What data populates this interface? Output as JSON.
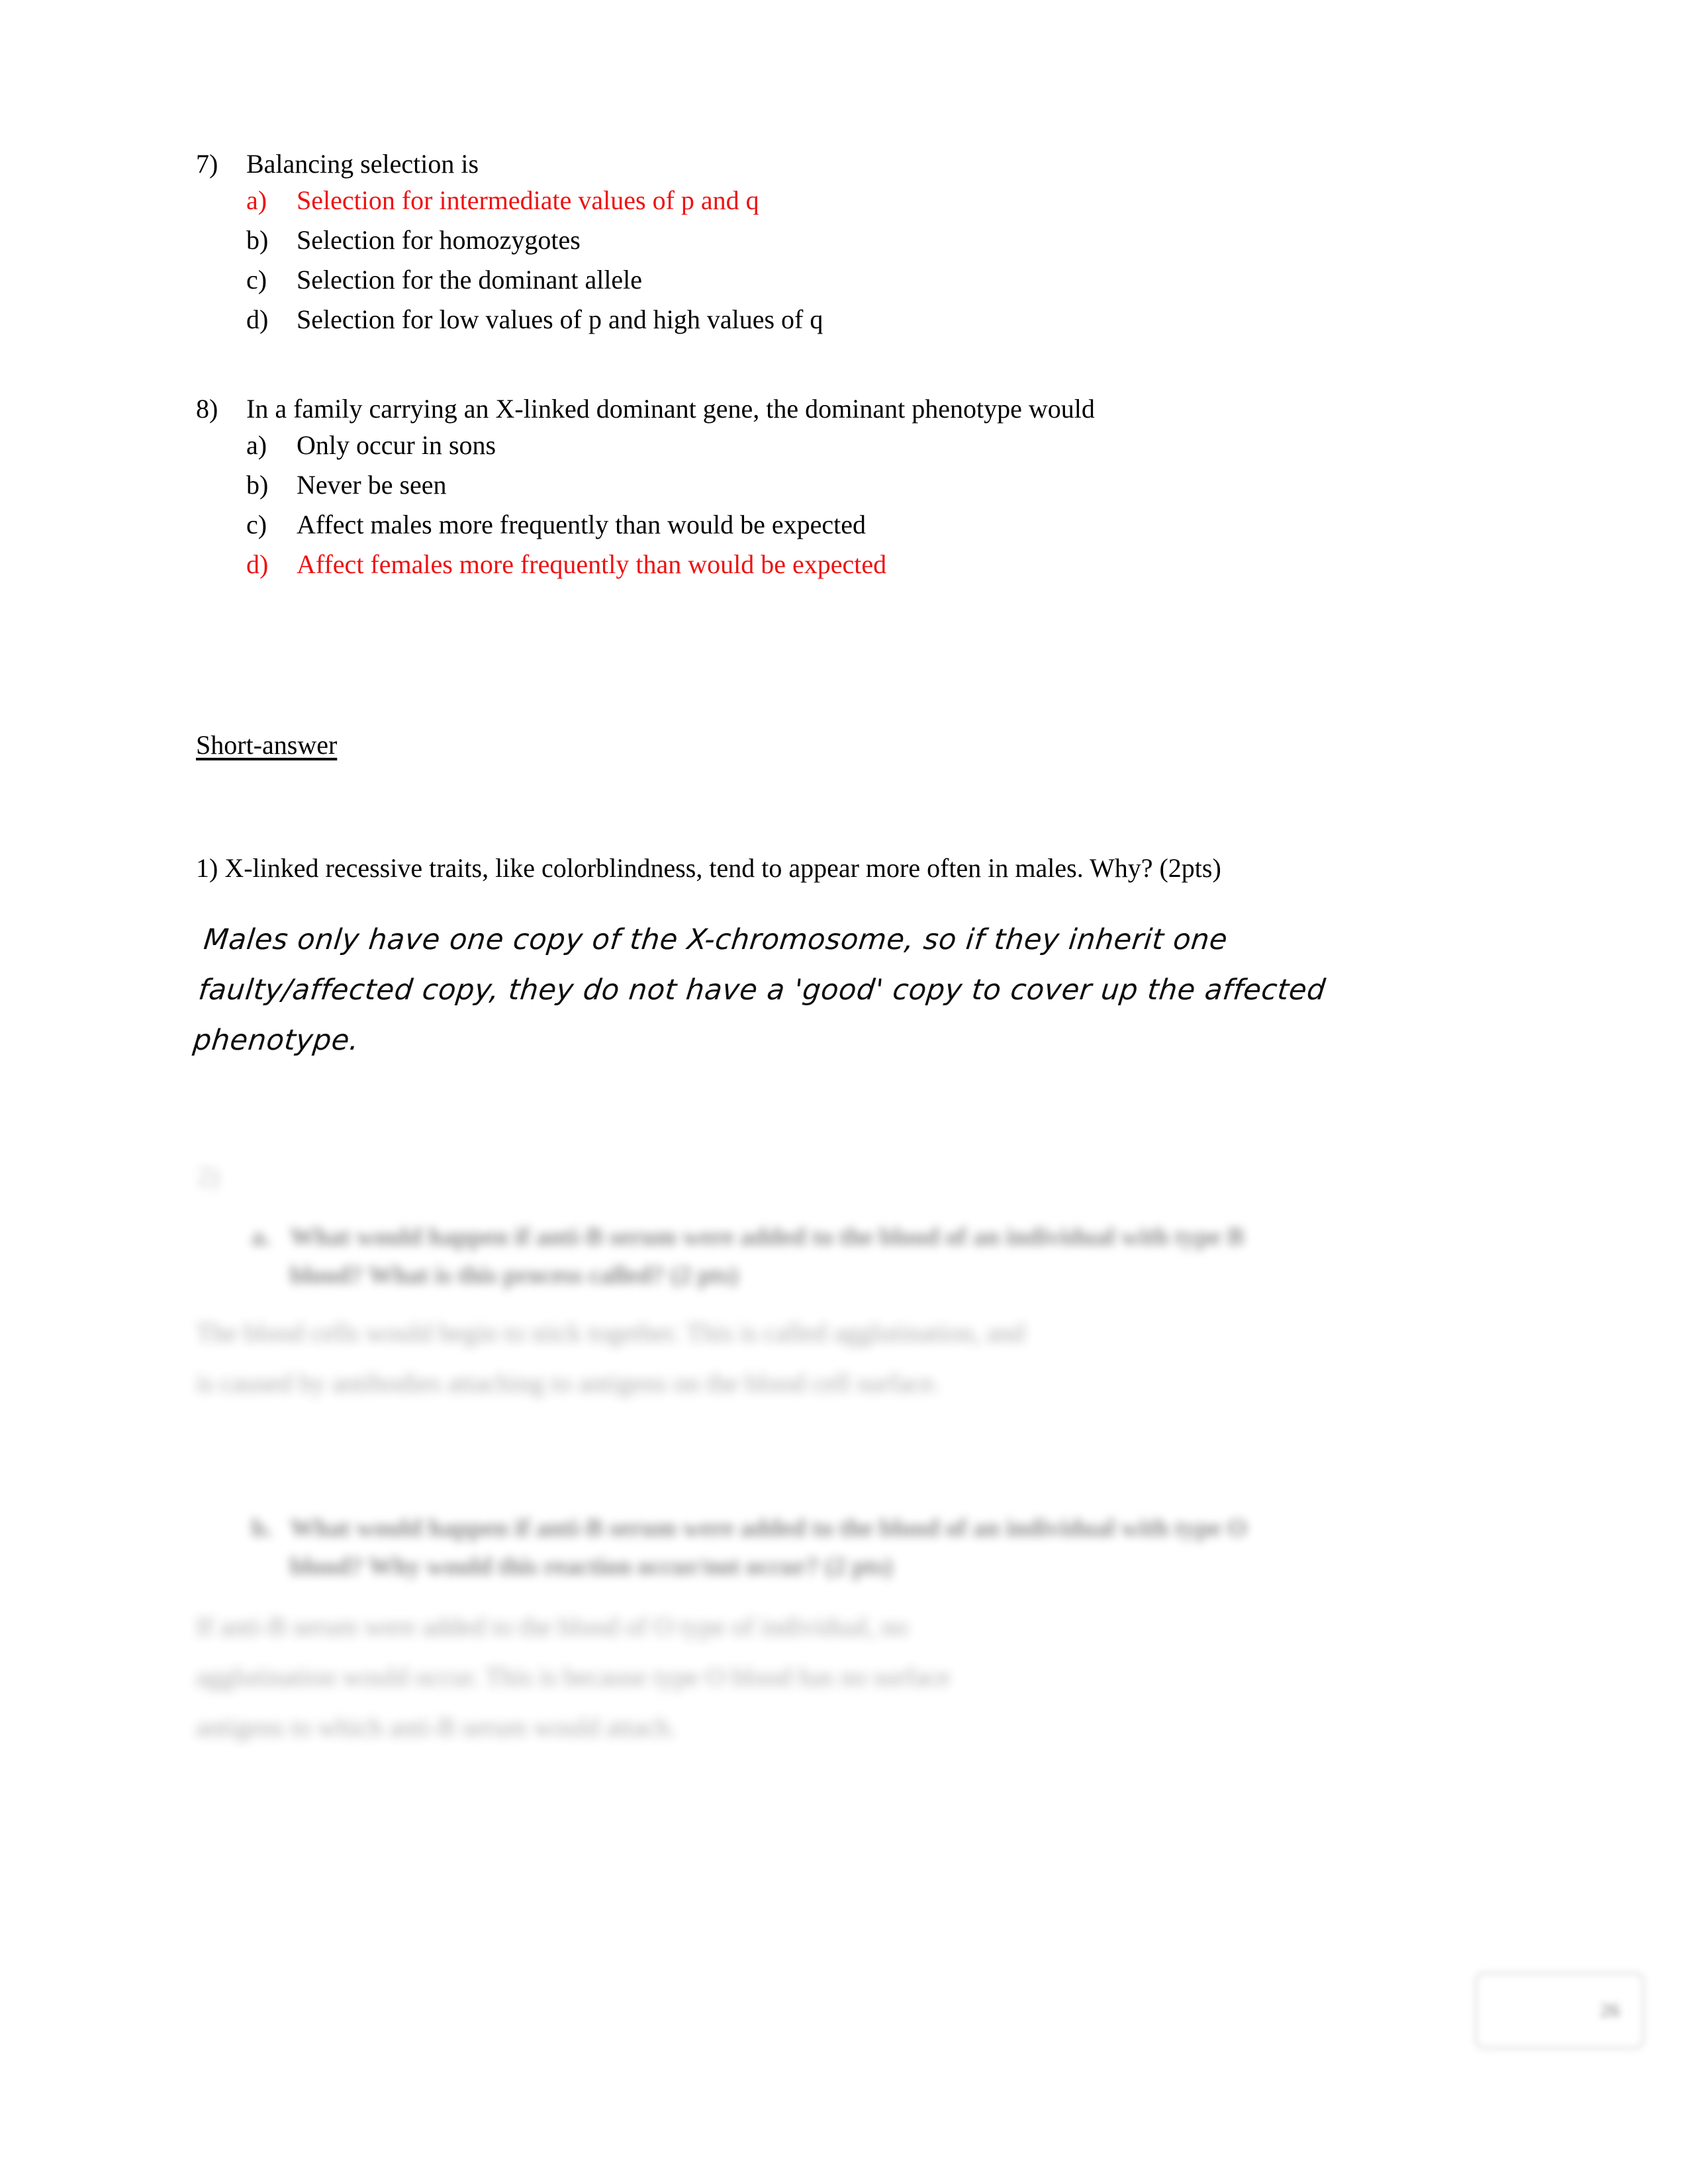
{
  "document": {
    "type": "exam-answer-key-page",
    "accent_correct_color": "#ee1111",
    "text_color": "#000000",
    "background_color": "#ffffff"
  },
  "multiple_choice": [
    {
      "number": "7)",
      "stem": "Balancing selection is",
      "options": [
        {
          "marker": "a)",
          "text": "Selection for intermediate values of p and q",
          "correct": true
        },
        {
          "marker": "b)",
          "text": "Selection for homozygotes",
          "correct": false
        },
        {
          "marker": "c)",
          "text": "Selection for the dominant allele",
          "correct": false
        },
        {
          "marker": "d)",
          "text": "Selection for low values of p and high values of q",
          "correct": false
        }
      ]
    },
    {
      "number": "8)",
      "stem": "In a family carrying an X-linked dominant gene, the dominant phenotype would",
      "options": [
        {
          "marker": "a)",
          "text": "Only occur in sons",
          "correct": false
        },
        {
          "marker": "b)",
          "text": "Never be seen",
          "correct": false
        },
        {
          "marker": "c)",
          "text": "Affect males more frequently than would be expected",
          "correct": false
        },
        {
          "marker": "d)",
          "text": "Affect females more frequently than would be expected",
          "correct": true
        }
      ]
    }
  ],
  "section": {
    "heading": "Short-answer"
  },
  "short_answer": {
    "question_1": {
      "text": "1) X-linked recessive traits, like colorblindness, tend to appear more often in males.  Why? (2pts)",
      "handwritten_answer_lines": [
        "Males only have one copy of the X-chromosome, so if they inherit one",
        "faulty/affected copy, they do not have a 'good' copy to cover up the affected",
        "phenotype."
      ]
    },
    "question_2": {
      "marker": "2)",
      "blurred": true,
      "parts": [
        {
          "marker": "a.",
          "prompt_lines": [
            "What would happen if anti-B serum were added to the blood of an individual with type B",
            "blood?  What is this process called? (2 pts)"
          ],
          "answer_lines": [
            "The blood cells would begin to stick together.  This is called agglutination, and",
            "is caused by antibodies attaching to antigens on the blood cell surface."
          ]
        },
        {
          "marker": "b.",
          "prompt_lines": [
            "What would happen if anti-B serum were added to the blood of an individual with type O",
            "blood?  Why would this reaction occur/not occur? (2 pts)"
          ],
          "answer_lines": [
            "If anti-B serum were added to the blood of O type of individual, no",
            "agglutination would occur.  This is because type O blood has no surface",
            "antigens to which anti-B serum would attach."
          ]
        }
      ]
    }
  },
  "page_badge": {
    "number": "26"
  }
}
